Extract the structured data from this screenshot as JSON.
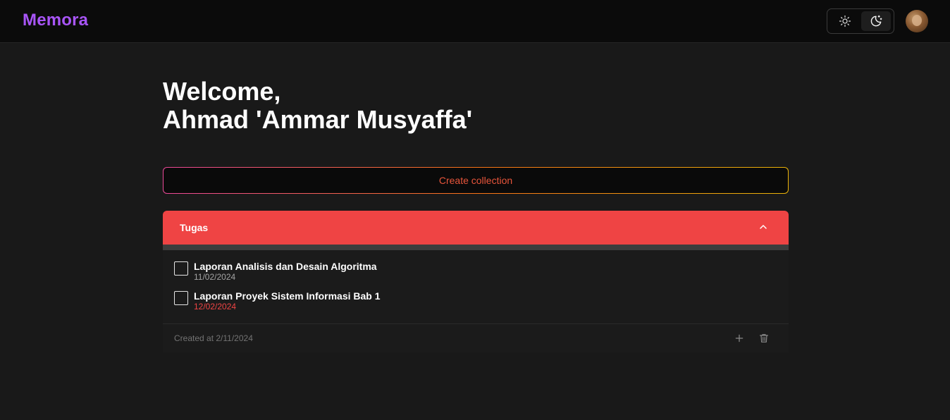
{
  "navbar": {
    "brand": "Memora",
    "theme": {
      "light_icon": "sun-icon",
      "dark_icon": "moon-stars-icon",
      "active": "dark"
    },
    "avatar_icon": "user-avatar"
  },
  "greeting": {
    "line1": "Welcome,",
    "line2": "Ahmad 'Ammar Musyaffa'"
  },
  "create_collection": {
    "label": "Create collection"
  },
  "collections": [
    {
      "name": "Tugas",
      "color": "#ef4444",
      "tasks": [
        {
          "title": "Laporan Analisis dan Desain Algoritma",
          "date": "11/02/2024",
          "checked": false,
          "overdue": false
        },
        {
          "title": "Laporan Proyek Sistem Informasi Bab 1",
          "date": "12/02/2024",
          "checked": false,
          "overdue": true
        }
      ],
      "created_at": "Created at 2/11/2024"
    }
  ],
  "colors": {
    "brand": "#a855f7",
    "accent_red": "#ef4444",
    "background": "#191919"
  }
}
